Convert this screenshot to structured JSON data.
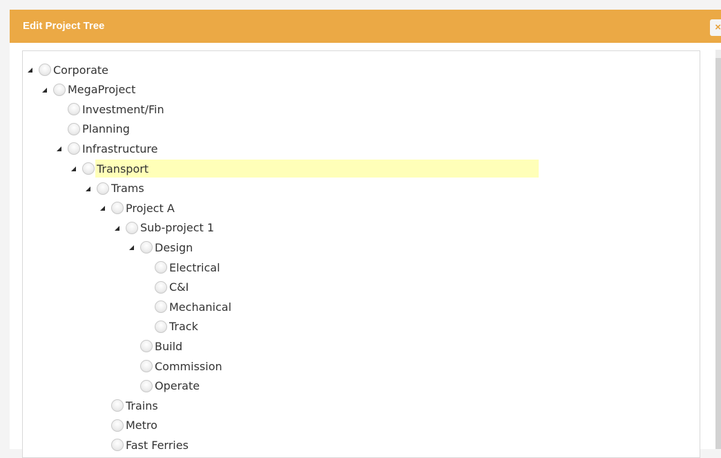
{
  "dialog": {
    "title": "Edit Project Tree",
    "close_label": "×"
  },
  "colors": {
    "header": "#eba945",
    "selected_row": "#ffffb8"
  },
  "tree": {
    "toggle_icon": "◢",
    "nodes": [
      {
        "label": "Corporate",
        "level": 0,
        "expanded": true
      },
      {
        "label": "MegaProject",
        "level": 1,
        "expanded": true
      },
      {
        "label": "Investment/Fin",
        "level": 2,
        "expanded": null
      },
      {
        "label": "Planning",
        "level": 2,
        "expanded": null
      },
      {
        "label": "Infrastructure",
        "level": 2,
        "expanded": true
      },
      {
        "label": "Transport",
        "level": 3,
        "expanded": true,
        "selected": true
      },
      {
        "label": "Trams",
        "level": 4,
        "expanded": true
      },
      {
        "label": "Project A",
        "level": 5,
        "expanded": true
      },
      {
        "label": "Sub-project 1",
        "level": 6,
        "expanded": true
      },
      {
        "label": "Design",
        "level": 7,
        "expanded": true
      },
      {
        "label": "Electrical",
        "level": 8,
        "expanded": null
      },
      {
        "label": "C&I",
        "level": 8,
        "expanded": null
      },
      {
        "label": "Mechanical",
        "level": 8,
        "expanded": null
      },
      {
        "label": "Track",
        "level": 8,
        "expanded": null
      },
      {
        "label": "Build",
        "level": 7,
        "expanded": null
      },
      {
        "label": "Commission",
        "level": 7,
        "expanded": null
      },
      {
        "label": "Operate",
        "level": 7,
        "expanded": null
      },
      {
        "label": "Trains",
        "level": 5,
        "expanded": null
      },
      {
        "label": "Metro",
        "level": 5,
        "expanded": null
      },
      {
        "label": "Fast Ferries",
        "level": 5,
        "expanded": null
      }
    ]
  }
}
